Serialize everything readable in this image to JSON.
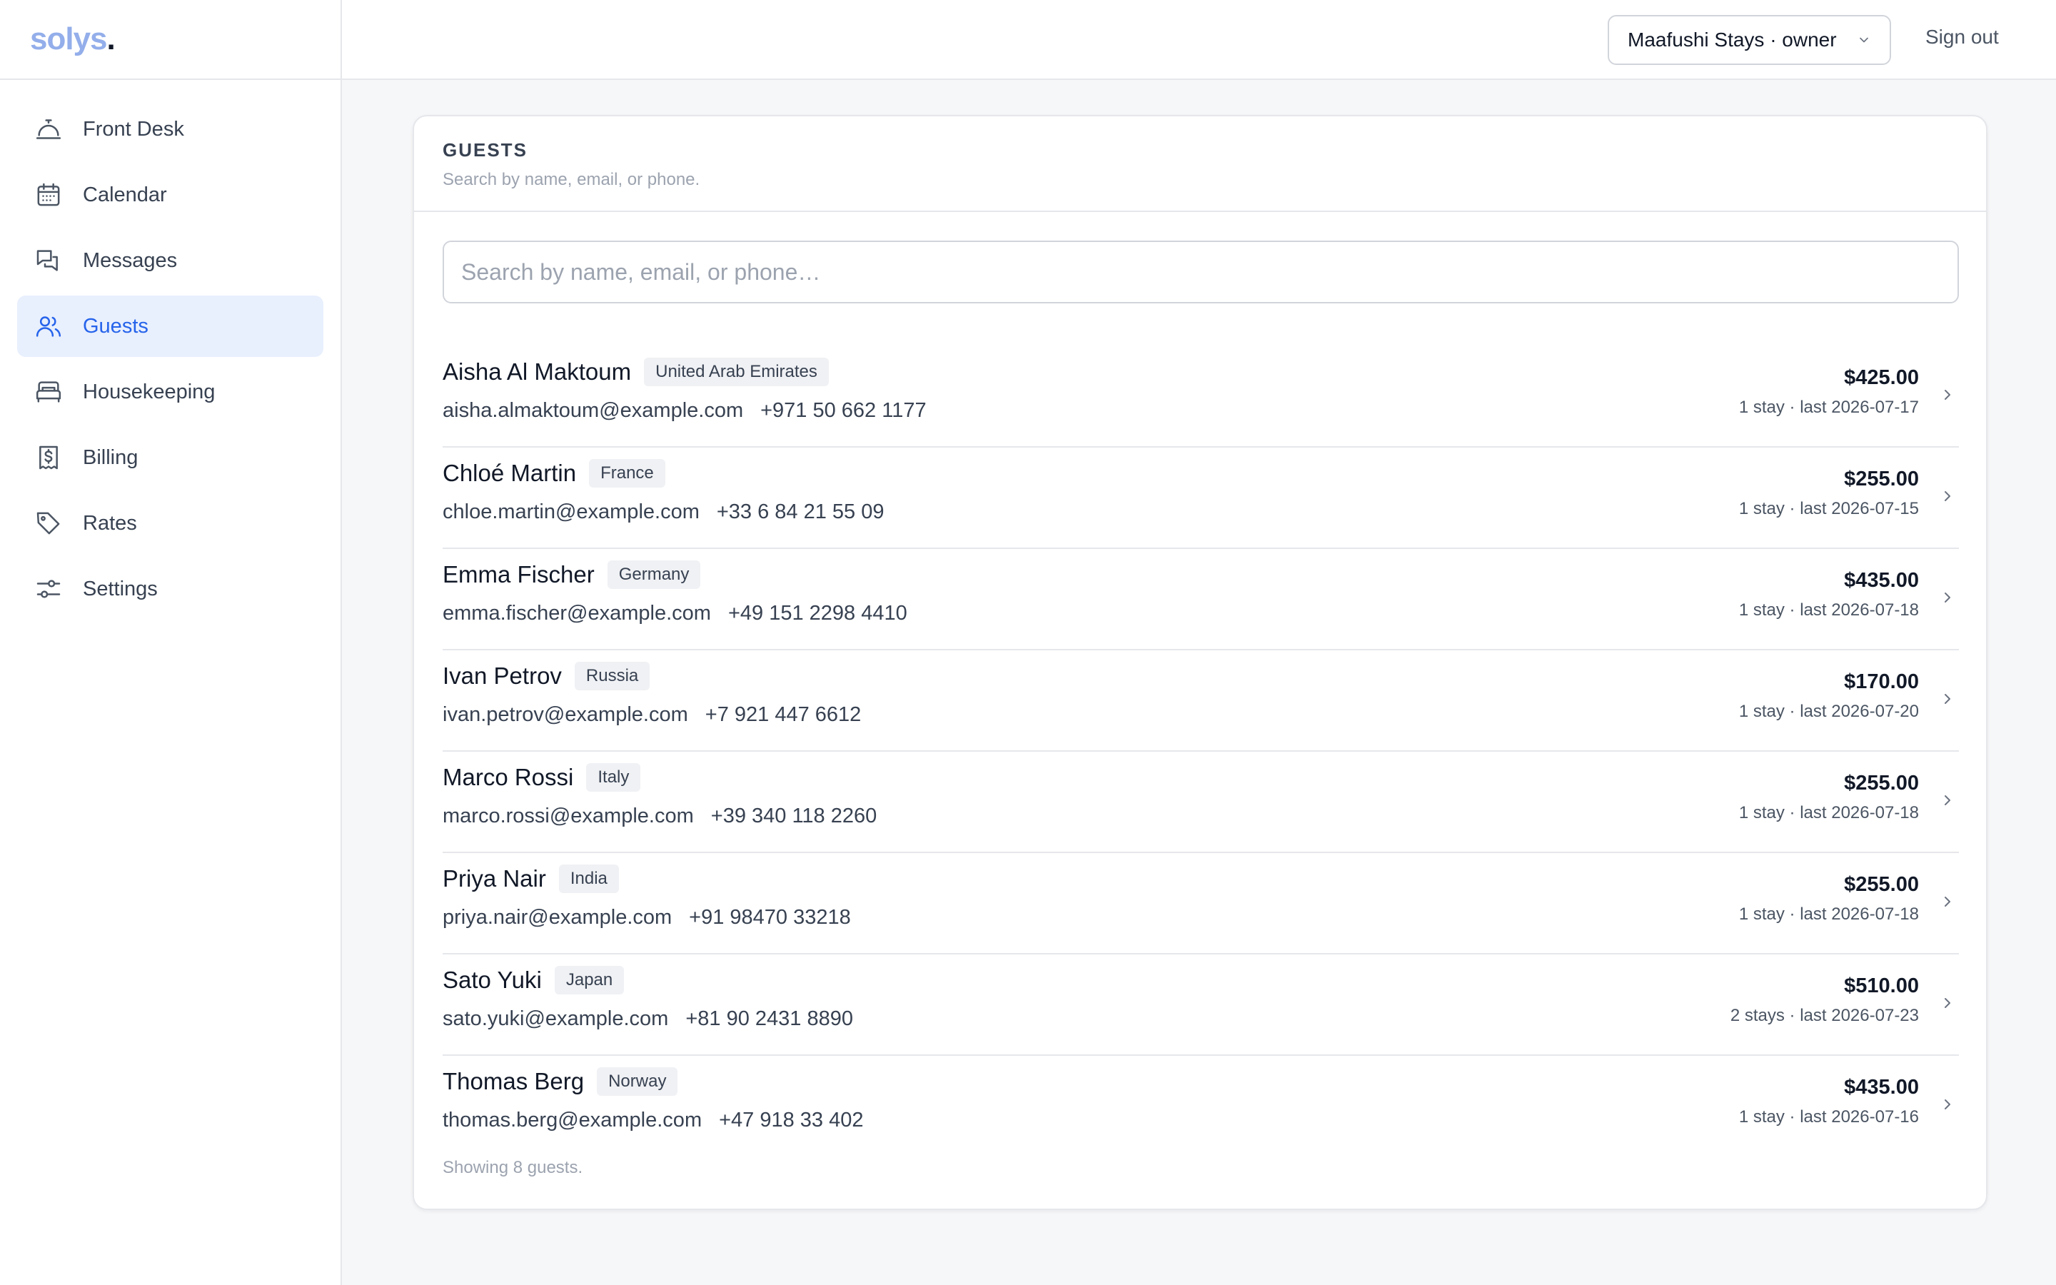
{
  "brand": {
    "name": "solys",
    "dot": "."
  },
  "nav": {
    "items": [
      {
        "label": "Front Desk",
        "icon": "bell-icon",
        "active": false
      },
      {
        "label": "Calendar",
        "icon": "calendar-icon",
        "active": false
      },
      {
        "label": "Messages",
        "icon": "chat-icon",
        "active": false
      },
      {
        "label": "Guests",
        "icon": "users-icon",
        "active": true
      },
      {
        "label": "Housekeeping",
        "icon": "bed-icon",
        "active": false
      },
      {
        "label": "Billing",
        "icon": "receipt-dollar-icon",
        "active": false
      },
      {
        "label": "Rates",
        "icon": "tag-icon",
        "active": false
      },
      {
        "label": "Settings",
        "icon": "sliders-icon",
        "active": false
      }
    ]
  },
  "header": {
    "property_selector": "Maafushi Stays · owner",
    "sign_out": "Sign out"
  },
  "guests": {
    "title": "GUESTS",
    "subtitle": "Search by name, email, or phone.",
    "search_placeholder": "Search by name, email, or phone…",
    "search_value": "",
    "rows": [
      {
        "name": "Aisha Al Maktoum",
        "country": "United Arab Emirates",
        "email": "aisha.almaktoum@example.com",
        "phone": "+971 50 662 1177",
        "total": "$425.00",
        "meta": "1 stay · last 2026-07-17"
      },
      {
        "name": "Chloé Martin",
        "country": "France",
        "email": "chloe.martin@example.com",
        "phone": "+33 6 84 21 55 09",
        "total": "$255.00",
        "meta": "1 stay · last 2026-07-15"
      },
      {
        "name": "Emma Fischer",
        "country": "Germany",
        "email": "emma.fischer@example.com",
        "phone": "+49 151 2298 4410",
        "total": "$435.00",
        "meta": "1 stay · last 2026-07-18"
      },
      {
        "name": "Ivan Petrov",
        "country": "Russia",
        "email": "ivan.petrov@example.com",
        "phone": "+7 921 447 6612",
        "total": "$170.00",
        "meta": "1 stay · last 2026-07-20"
      },
      {
        "name": "Marco Rossi",
        "country": "Italy",
        "email": "marco.rossi@example.com",
        "phone": "+39 340 118 2260",
        "total": "$255.00",
        "meta": "1 stay · last 2026-07-18"
      },
      {
        "name": "Priya Nair",
        "country": "India",
        "email": "priya.nair@example.com",
        "phone": "+91 98470 33218",
        "total": "$255.00",
        "meta": "1 stay · last 2026-07-18"
      },
      {
        "name": "Sato Yuki",
        "country": "Japan",
        "email": "sato.yuki@example.com",
        "phone": "+81 90 2431 8890",
        "total": "$510.00",
        "meta": "2 stays · last 2026-07-23"
      },
      {
        "name": "Thomas Berg",
        "country": "Norway",
        "email": "thomas.berg@example.com",
        "phone": "+47 918 33 402",
        "total": "$435.00",
        "meta": "1 stay · last 2026-07-16"
      }
    ],
    "footer": "Showing 8 guests."
  },
  "colors": {
    "accent": "#2563eb",
    "brand": "#93aeea",
    "active_bg": "#e8effd"
  }
}
